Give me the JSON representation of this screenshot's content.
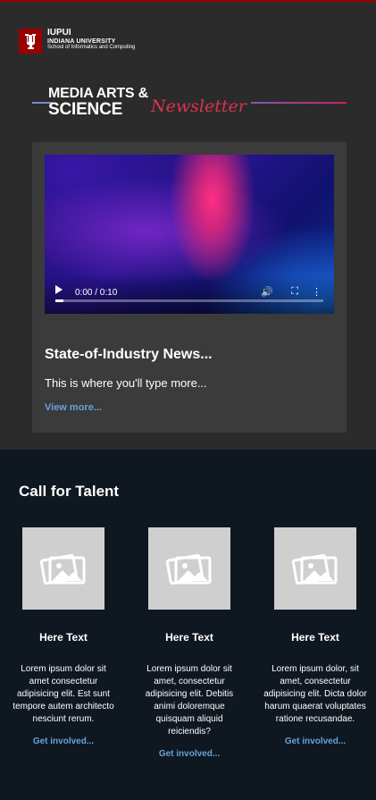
{
  "header": {
    "org": "IUPUI",
    "university": "INDIANA UNIVERSITY",
    "school": "School of Informatics and Computing",
    "logo_icon": "trident-icon",
    "brand_red": "#990000"
  },
  "masthead": {
    "line1": "MEDIA ARTS &",
    "line2": "SCIENCE",
    "script": "Newsletter",
    "script_color": "#d8344e"
  },
  "feature": {
    "video": {
      "time": "0:00 / 0:10",
      "progress": 0.03,
      "controls": [
        "play-icon",
        "volume-icon",
        "fullscreen-icon",
        "more-icon"
      ]
    },
    "title": "State-of-Industry News...",
    "body": "This is where you'll type more...",
    "link": "View more..."
  },
  "talent": {
    "heading": "Call for Talent",
    "columns": [
      {
        "heading": "Here Text",
        "body": "Lorem ipsum dolor sit amet consectetur adipisicing elit. Est sunt tempore autem architecto nesciunt rerum.",
        "link": "Get involved..."
      },
      {
        "heading": "Here Text",
        "body": "Lorem ipsum dolor sit amet, consectetur adipisicing elit. Debitis animi doloremque quisquam aliquid reiciendis?",
        "link": "Get involved..."
      },
      {
        "heading": "Here Text",
        "body": "Lorem ipsum dolor, sit amet, consectetur adipisicing elit. Dicta dolor harum quaerat voluptates ratione recusandae.",
        "link": "Get involved..."
      }
    ]
  },
  "colors": {
    "link": "#66a3d9",
    "top_bg": "#2b2b2b",
    "bottom_bg": "#0f1720"
  }
}
